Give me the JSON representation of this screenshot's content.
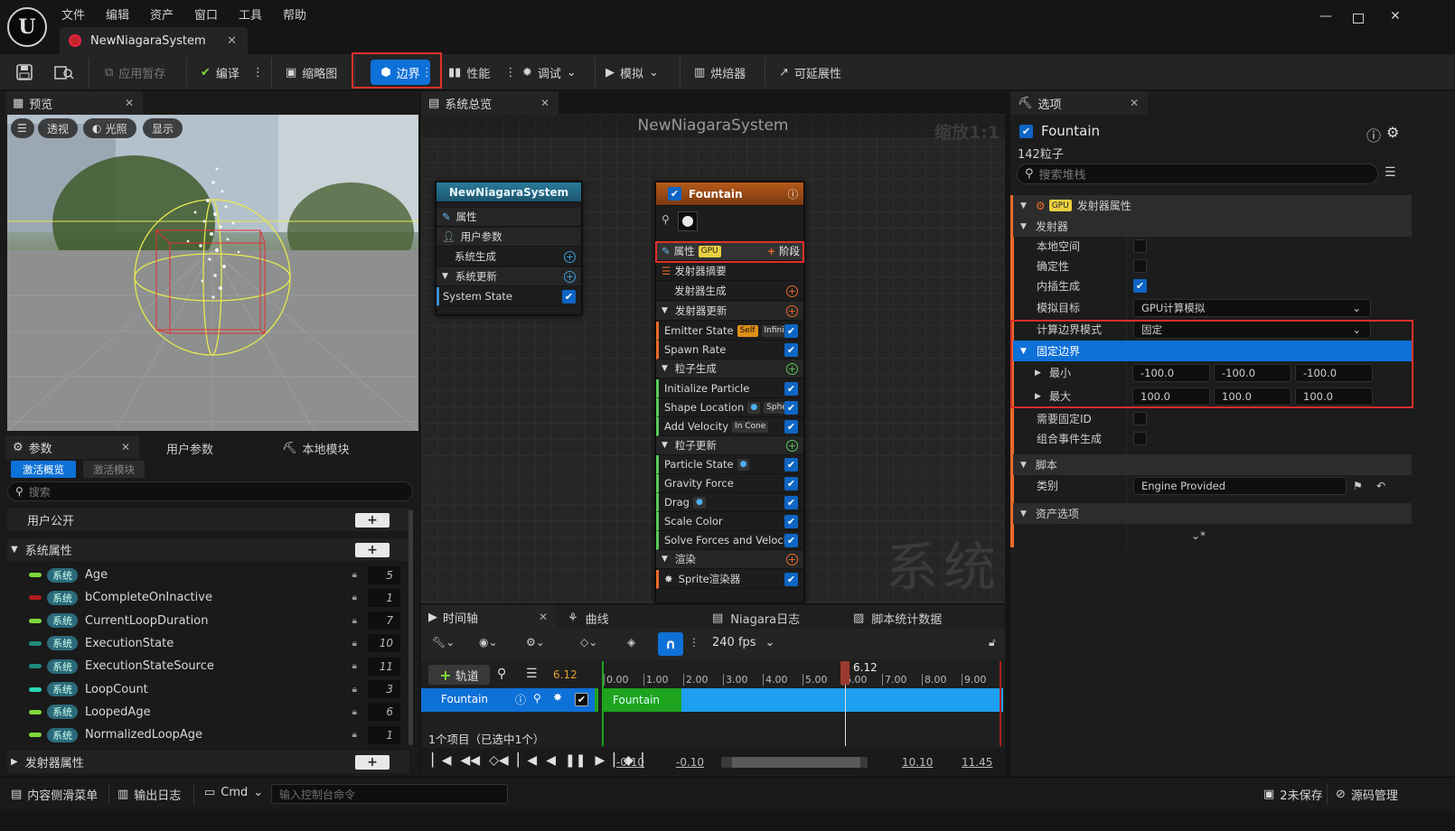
{
  "menu": [
    "文件",
    "编辑",
    "资产",
    "窗口",
    "工具",
    "帮助"
  ],
  "document_tab": "NewNiagaraSystem",
  "toolbar": {
    "apply_pause": "应用暂存",
    "compile": "编译",
    "thumbnail": "缩略图",
    "bounds": "边界",
    "performance": "性能",
    "debug": "调试",
    "simulate": "模拟",
    "baker": "烘焙器",
    "scalability": "可延展性"
  },
  "preview": {
    "tab": "预览",
    "perspective": "透视",
    "lit": "光照",
    "show": "显示"
  },
  "params": {
    "tab": "参数",
    "tab_user": "用户参数",
    "tab_local": "本地模块",
    "filter_active": "激活概览",
    "filter_modules": "激活模块",
    "search_placeholder": "搜索",
    "user_exposed": "用户公开",
    "system_attributes": "系统属性",
    "emitter_attributes": "发射器属性",
    "sys_tag": "系统",
    "rows": [
      {
        "name": "Age",
        "value": "5",
        "color": "#7fd83a"
      },
      {
        "name": "bCompleteOnInactive",
        "value": "1",
        "color": "#b01c1c"
      },
      {
        "name": "CurrentLoopDuration",
        "value": "7",
        "color": "#7fd83a"
      },
      {
        "name": "ExecutionState",
        "value": "10",
        "color": "#1f8a7a"
      },
      {
        "name": "ExecutionStateSource",
        "value": "11",
        "color": "#1f8a7a"
      },
      {
        "name": "LoopCount",
        "value": "3",
        "color": "#29d8b0"
      },
      {
        "name": "LoopedAge",
        "value": "6",
        "color": "#7fd83a"
      },
      {
        "name": "NormalizedLoopAge",
        "value": "1",
        "color": "#7fd83a"
      }
    ]
  },
  "overview": {
    "tab": "系统总览",
    "title": "NewNiagaraSystem",
    "zoom": "缩放1:1",
    "watermark": "系统",
    "system_node": {
      "title": "NewNiagaraSystem",
      "properties": "属性",
      "user_params": "用户参数",
      "system_spawn": "系统生成",
      "system_update": "系统更新",
      "system_state": "System State"
    },
    "emitter_node": {
      "title": "Fountain",
      "properties": "属性",
      "gpu": "GPU",
      "stage": "阶段",
      "summary": "发射器摘要",
      "emitter_spawn": "发射器生成",
      "emitter_update": "发射器更新",
      "emitter_state": "Emitter State",
      "self": "Self",
      "infinite": "Infinite",
      "spawn_rate": "Spawn Rate",
      "particle_spawn": "粒子生成",
      "init_particle": "Initialize Particle",
      "shape_location": "Shape Location",
      "sphere": "Sphere",
      "add_velocity": "Add Velocity",
      "in_cone": "In Cone",
      "particle_update": "粒子更新",
      "particle_state": "Particle State",
      "gravity_force": "Gravity Force",
      "drag": "Drag",
      "scale_color": "Scale Color",
      "solve_forces": "Solve Forces and Velocity",
      "render": "渲染",
      "sprite_renderer": "Sprite渲染器"
    }
  },
  "timeline": {
    "tab": "时间轴",
    "tab_curves": "曲线",
    "tab_log": "Niagara日志",
    "tab_stats": "脚本统计数据",
    "fps": "240 fps",
    "add_track": "轨道",
    "current_time": "6.12",
    "ticks": [
      "0.00",
      "1.00",
      "2.00",
      "3.00",
      "4.00",
      "5.00",
      "6.00",
      "7.00",
      "8.00",
      "9.00"
    ],
    "track_name": "Fountain",
    "bar_label": "Fountain",
    "items_status": "1个项目（已选中1个）",
    "range_start_a": "-0.10",
    "range_start_b": "-0.10",
    "range_end_a": "10.10",
    "range_end_b": "11.45"
  },
  "details": {
    "tab": "选项",
    "emitter_name": "Fountain",
    "particle_count": "142粒子",
    "search_placeholder": "搜索堆栈",
    "section_emitter_props": "发射器属性",
    "gpu": "GPU",
    "cat_emitter": "发射器",
    "local_space": "本地空间",
    "determinism": "确定性",
    "interpolated_spawn": "内插生成",
    "sim_target_label": "模拟目标",
    "sim_target_value": "GPU计算模拟",
    "calc_bounds_label": "计算边界模式",
    "calc_bounds_value": "固定",
    "fixed_bounds": "固定边界",
    "min_label": "最小",
    "min_values": [
      "-100.0",
      "-100.0",
      "-100.0"
    ],
    "max_label": "最大",
    "max_values": [
      "100.0",
      "100.0",
      "100.0"
    ],
    "requires_fixed_id": "需要固定ID",
    "combine_event_spawn": "组合事件生成",
    "cat_script": "脚本",
    "category_label": "类别",
    "category_value": "Engine Provided",
    "cat_asset_options": "资产选项"
  },
  "bottombar": {
    "content_drawer": "内容侧滑菜单",
    "output_log": "输出日志",
    "cmd": "Cmd",
    "console_placeholder": "输入控制台命令",
    "unsaved": "2未保存",
    "source_control": "源码管理"
  }
}
